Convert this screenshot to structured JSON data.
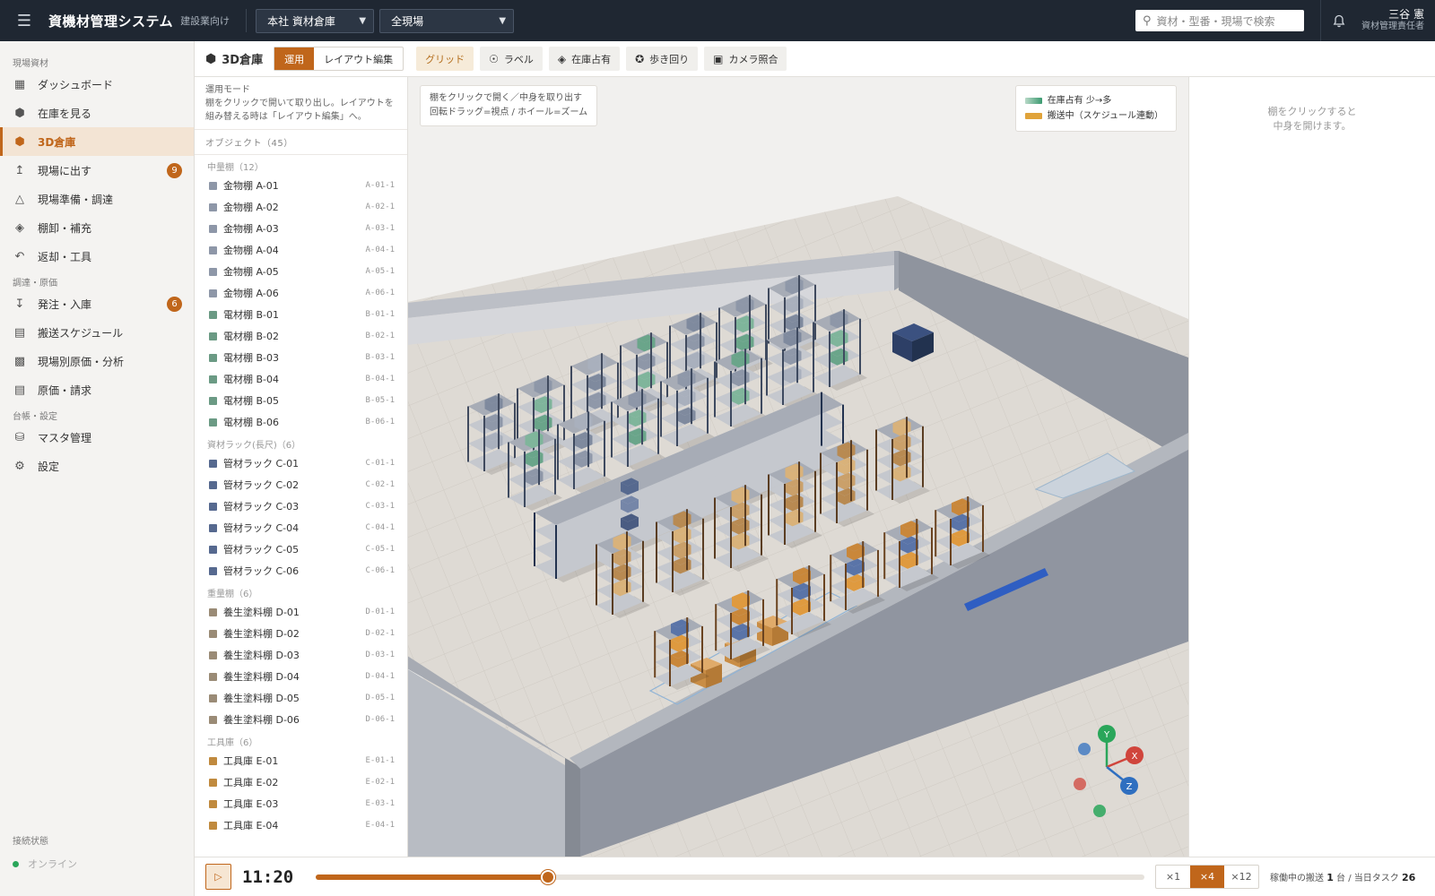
{
  "header": {
    "app_title": "資機材管理システム",
    "app_subtitle": "建設業向け",
    "warehouse_select": "本社 資材倉庫",
    "site_select": "全現場",
    "search_placeholder": "資材・型番・現場で検索",
    "user_name": "三谷 憲",
    "user_role": "資材管理責任者"
  },
  "sidebar": {
    "sections": [
      {
        "label": "現場資材",
        "items": [
          {
            "label": "ダッシュボード",
            "icon": "dashboard-icon"
          },
          {
            "label": "在庫を見る",
            "icon": "box-icon"
          },
          {
            "label": "3D倉庫",
            "icon": "cube-icon",
            "active": true
          },
          {
            "label": "現場に出す",
            "icon": "upload-icon",
            "badge": "9"
          },
          {
            "label": "現場準備・調達",
            "icon": "helmet-icon"
          },
          {
            "label": "棚卸・補充",
            "icon": "layers-icon"
          },
          {
            "label": "返却・工具",
            "icon": "return-icon"
          }
        ]
      },
      {
        "label": "調達・原価",
        "items": [
          {
            "label": "発注・入庫",
            "icon": "download-icon",
            "badge": "6"
          },
          {
            "label": "搬送スケジュール",
            "icon": "calendar-icon"
          },
          {
            "label": "現場別原価・分析",
            "icon": "bar-chart-icon"
          },
          {
            "label": "原価・請求",
            "icon": "document-icon"
          }
        ]
      },
      {
        "label": "台帳・設定",
        "items": [
          {
            "label": "マスタ管理",
            "icon": "database-icon"
          },
          {
            "label": "設定",
            "icon": "gear-icon"
          }
        ]
      }
    ],
    "connection_label": "接続状態",
    "connection_status": "オンライン"
  },
  "toolbar": {
    "title": "3D倉庫",
    "mode_run": "運用",
    "mode_edit": "レイアウト編集",
    "grid": "グリッド",
    "label": "ラベル",
    "occupancy": "在庫占有",
    "walk": "歩き回り",
    "camera": "カメラ照合"
  },
  "panel": {
    "mode_title": "運用モード",
    "mode_desc": "棚をクリックで開いて取り出し。レイアウトを組み替える時は「レイアウト編集」へ。",
    "objects_header": "オブジェクト（45）",
    "groups": [
      {
        "label": "中量棚（12）",
        "color": "#8e97a8",
        "items": [
          [
            "金物棚 A-01",
            "A-01-1"
          ],
          [
            "金物棚 A-02",
            "A-02-1"
          ],
          [
            "金物棚 A-03",
            "A-03-1"
          ],
          [
            "金物棚 A-04",
            "A-04-1"
          ],
          [
            "金物棚 A-05",
            "A-05-1"
          ],
          [
            "金物棚 A-06",
            "A-06-1"
          ],
          [
            "電材棚 B-01",
            "B-01-1"
          ],
          [
            "電材棚 B-02",
            "B-02-1"
          ],
          [
            "電材棚 B-03",
            "B-03-1"
          ],
          [
            "電材棚 B-04",
            "B-04-1"
          ],
          [
            "電材棚 B-05",
            "B-05-1"
          ],
          [
            "電材棚 B-06",
            "B-06-1"
          ]
        ],
        "colors": [
          "#8e97a8",
          "#8e97a8",
          "#8e97a8",
          "#8e97a8",
          "#8e97a8",
          "#8e97a8",
          "#6b9a84",
          "#6b9a84",
          "#6b9a84",
          "#6b9a84",
          "#6b9a84",
          "#6b9a84"
        ]
      },
      {
        "label": "資材ラック(長尺)（6）",
        "items": [
          [
            "管材ラック C-01",
            "C-01-1"
          ],
          [
            "管材ラック C-02",
            "C-02-1"
          ],
          [
            "管材ラック C-03",
            "C-03-1"
          ],
          [
            "管材ラック C-04",
            "C-04-1"
          ],
          [
            "管材ラック C-05",
            "C-05-1"
          ],
          [
            "管材ラック C-06",
            "C-06-1"
          ]
        ],
        "colors": [
          "#56698f",
          "#56698f",
          "#56698f",
          "#56698f",
          "#56698f",
          "#56698f"
        ]
      },
      {
        "label": "重量棚（6）",
        "items": [
          [
            "養生塗料棚 D-01",
            "D-01-1"
          ],
          [
            "養生塗料棚 D-02",
            "D-02-1"
          ],
          [
            "養生塗料棚 D-03",
            "D-03-1"
          ],
          [
            "養生塗料棚 D-04",
            "D-04-1"
          ],
          [
            "養生塗料棚 D-05",
            "D-05-1"
          ],
          [
            "養生塗料棚 D-06",
            "D-06-1"
          ]
        ],
        "colors": [
          "#9a8b76",
          "#9a8b76",
          "#9a8b76",
          "#9a8b76",
          "#9a8b76",
          "#9a8b76"
        ]
      },
      {
        "label": "工具庫（6）",
        "items": [
          [
            "工具庫 E-01",
            "E-01-1"
          ],
          [
            "工具庫 E-02",
            "E-02-1"
          ],
          [
            "工具庫 E-03",
            "E-03-1"
          ],
          [
            "工具庫 E-04",
            "E-04-1"
          ]
        ],
        "colors": [
          "#c08a3e",
          "#c08a3e",
          "#c08a3e",
          "#c08a3e"
        ]
      }
    ]
  },
  "viewport": {
    "hint_line1": "棚をクリックで開く／中身を取り出す",
    "hint_line2": "回転ドラッグ=視点 / ホイール=ズーム",
    "legend_occupancy": "在庫占有 少→多",
    "legend_transport": "搬送中（スケジュール連動）",
    "axis_x": "X",
    "axis_y": "Y",
    "axis_z": "Z"
  },
  "details": {
    "empty_line1": "棚をクリックすると",
    "empty_line2": "中身を開けます。"
  },
  "timeline": {
    "time": "11:20",
    "progress": 0.28,
    "speeds": [
      "×1",
      "×4",
      "×12"
    ],
    "active_speed": "×4",
    "stat_prefix": "稼働中の搬送",
    "stat_moving": "1",
    "stat_mid": "台 / 当日タスク",
    "stat_tasks": "26"
  },
  "colors": {
    "accent": "#c0661b",
    "header_bg": "#1f2732",
    "legend_transport": "#e0a33a"
  }
}
